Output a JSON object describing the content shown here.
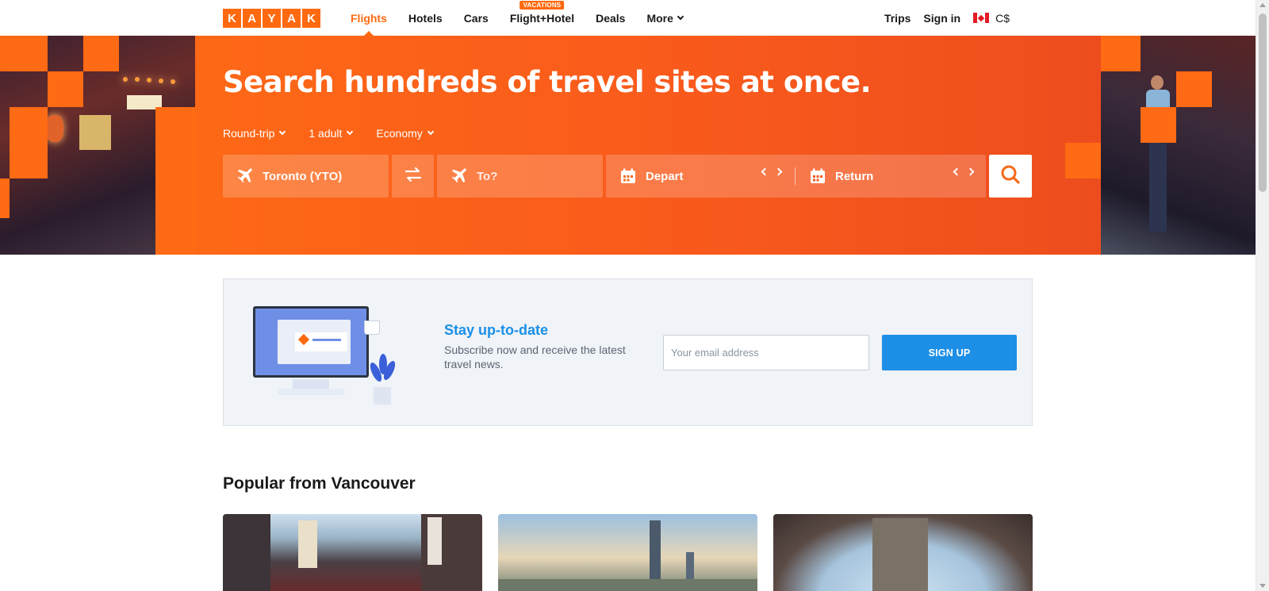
{
  "brand": {
    "logo_letters": [
      "K",
      "A",
      "Y",
      "A",
      "K"
    ],
    "accent_color": "#ff690f"
  },
  "nav": {
    "items": [
      {
        "label": "Flights",
        "active": true
      },
      {
        "label": "Hotels"
      },
      {
        "label": "Cars"
      },
      {
        "label": "Flight+Hotel",
        "badge": "VACATIONS"
      },
      {
        "label": "Deals"
      },
      {
        "label": "More"
      }
    ],
    "trips": "Trips",
    "sign_in": "Sign in",
    "currency": "C$",
    "flag_icon": "canada-flag-icon"
  },
  "hero": {
    "title": "Search hundreds of travel sites at once.",
    "trip_type": "Round-trip",
    "travelers": "1 adult",
    "cabin": "Economy",
    "origin": "Toronto (YTO)",
    "destination_placeholder": "To?",
    "depart_label": "Depart",
    "return_label": "Return",
    "swap_icon": "swap-icon",
    "search_icon": "search-icon"
  },
  "newsletter": {
    "title": "Stay up-to-date",
    "subtitle": "Subscribe now and receive the latest travel news.",
    "email_placeholder": "Your email address",
    "button_label": "SIGN UP",
    "button_color": "#1d8fe6"
  },
  "popular": {
    "title": "Popular from Vancouver"
  }
}
